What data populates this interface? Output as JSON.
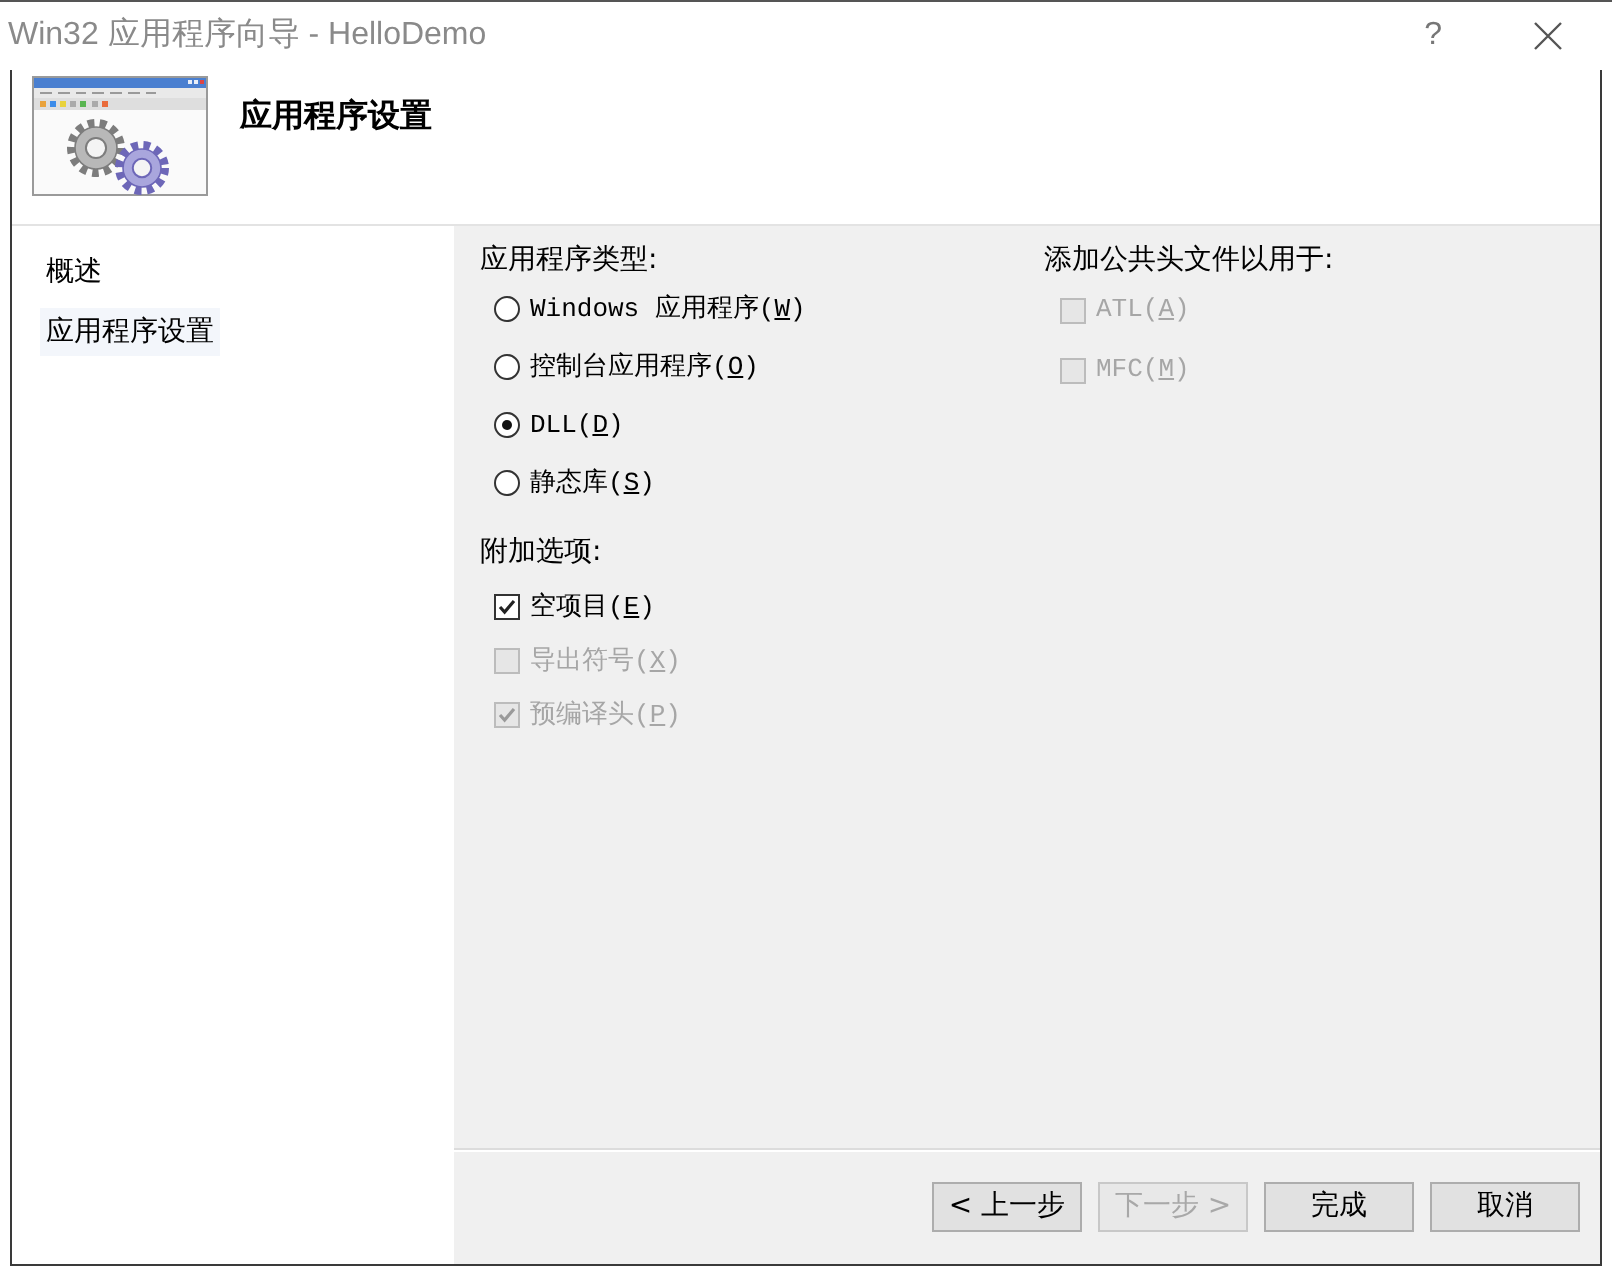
{
  "window": {
    "title": "Win32 应用程序向导 - HelloDemo",
    "help_label": "?"
  },
  "header": {
    "title": "应用程序设置"
  },
  "sidebar": {
    "items": [
      {
        "label": "概述",
        "selected": false
      },
      {
        "label": "应用程序设置",
        "selected": true
      }
    ]
  },
  "application_type": {
    "label": "应用程序类型:",
    "options": [
      {
        "label": "Windows 应用程序(",
        "access_key": "W",
        "label_end": ")",
        "selected": false
      },
      {
        "label": "控制台应用程序(",
        "access_key": "O",
        "label_end": ")",
        "selected": false
      },
      {
        "label": "DLL(",
        "access_key": "D",
        "label_end": ")",
        "selected": true
      },
      {
        "label": "静态库(",
        "access_key": "S",
        "label_end": ")",
        "selected": false
      }
    ]
  },
  "additional_options": {
    "label": "附加选项:",
    "options": [
      {
        "label": "空项目(",
        "access_key": "E",
        "label_end": ")",
        "checked": true,
        "disabled": false
      },
      {
        "label": "导出符号(",
        "access_key": "X",
        "label_end": ")",
        "checked": false,
        "disabled": true
      },
      {
        "label": "预编译头(",
        "access_key": "P",
        "label_end": ")",
        "checked": true,
        "disabled": true
      }
    ]
  },
  "common_headers": {
    "label": "添加公共头文件以用于:",
    "options": [
      {
        "label": "ATL(",
        "access_key": "A",
        "label_end": ")",
        "checked": false,
        "disabled": true
      },
      {
        "label": "MFC(",
        "access_key": "M",
        "label_end": ")",
        "checked": false,
        "disabled": true
      }
    ]
  },
  "buttons": [
    {
      "label": "< 上一步",
      "disabled": false
    },
    {
      "label": "下一步 >",
      "disabled": true
    },
    {
      "label": "完成",
      "disabled": false
    },
    {
      "label": "取消",
      "disabled": false
    }
  ]
}
